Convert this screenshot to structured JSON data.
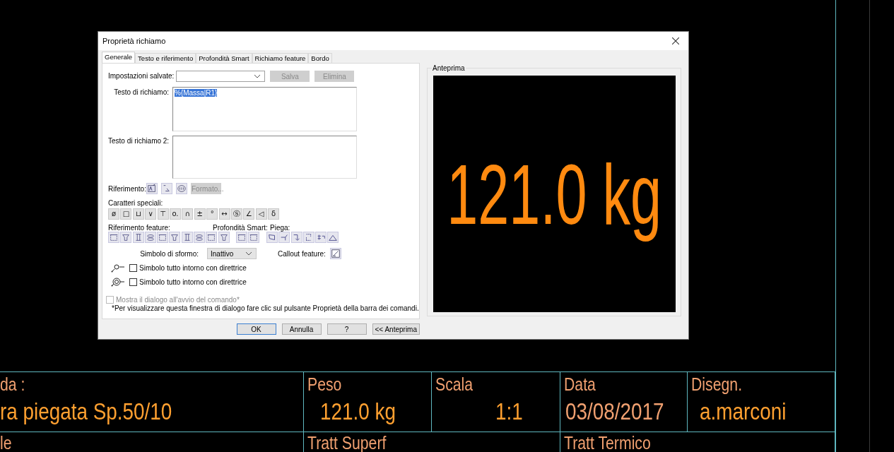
{
  "dialog": {
    "title": "Proprietà richiamo",
    "tabs": [
      {
        "label": "Generale",
        "selected": true
      },
      {
        "label": "Testo e riferimento",
        "selected": false
      },
      {
        "label": "Profondità Smart",
        "selected": false
      },
      {
        "label": "Richiamo feature",
        "selected": false
      },
      {
        "label": "Bordo",
        "selected": false
      }
    ],
    "saved_settings": {
      "label": "Impostazioni salvate:",
      "buttons": [
        {
          "label": "Salva",
          "disabled": true
        },
        {
          "label": "Elimina",
          "disabled": true
        }
      ]
    },
    "callout_text": {
      "label": "Testo di richiamo:",
      "value": "%{Massa|R1}",
      "selected": true
    },
    "callout_text_2": {
      "label": "Testo di richiamo 2:"
    },
    "reference": {
      "label": "Riferimento:",
      "format_button": {
        "label": "Formato...",
        "disabled": true
      }
    },
    "special_characters": {
      "label": "Caratteri speciali:",
      "keys": [
        "ø",
        "□",
        "⊔",
        "∨",
        "⊤",
        "o.",
        "∩",
        "±",
        "°",
        "↔",
        "Ⓢ",
        "∠",
        "◁",
        "δ"
      ]
    },
    "feature_reference": {
      "label": "Riferimento feature:"
    },
    "smart_depth": {
      "label": "Profondità Smart:"
    },
    "bend": {
      "label": "Piega:"
    },
    "draft_symbol": {
      "label": "Simbolo di sformo:",
      "value": "Inattivo"
    },
    "callout_feature": {
      "label": "Callout feature:"
    },
    "options": [
      {
        "label": "Simbolo tutto intorno con direttrice",
        "checked": false
      },
      {
        "label": "Simbolo tutto intorno con direttrice",
        "checked": false
      }
    ],
    "show_on_start": {
      "label": "Mostra il dialogo all'avvio del comando*",
      "checked": false,
      "disabled": true
    },
    "note": "*Per visualizzare questa finestra di dialogo fare clic sul pulsante Proprietà della barra dei comandi.",
    "preview": {
      "label": "Anteprima",
      "text": "121.0 kg"
    },
    "buttons": [
      {
        "label": "OK",
        "default": true
      },
      {
        "label": "Annulla",
        "default": false
      },
      {
        "label": "?",
        "default": false
      },
      {
        "label": "<< Anteprima",
        "default": false
      }
    ]
  },
  "title_block": {
    "rows": [
      [
        {
          "label": "da :",
          "value": "ra piegata Sp.50/10"
        },
        {
          "label": "Peso",
          "value": "121.0 kg"
        },
        {
          "label": "Scala",
          "value": "1:1"
        },
        {
          "label": "Data",
          "value": "03/08/2017"
        },
        {
          "label": "Disegn.",
          "value": "a.marconi"
        }
      ],
      [
        {
          "label": "le"
        },
        {
          "label": "Tratt Superf",
          "colspan": 2
        },
        {
          "label": "Tratt Termico",
          "colspan": 2
        }
      ]
    ]
  }
}
